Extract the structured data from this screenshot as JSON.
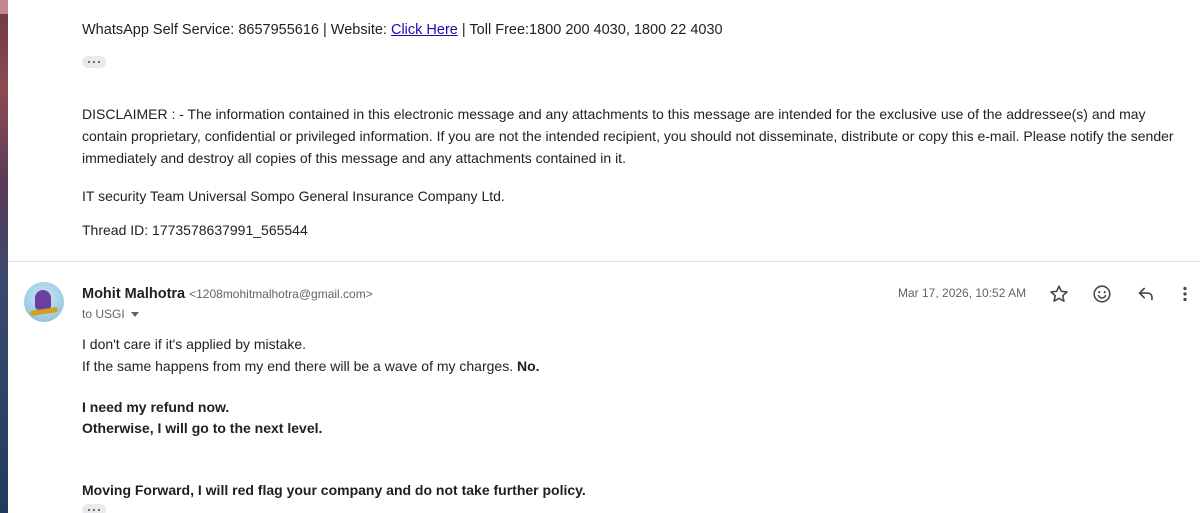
{
  "previous_message": {
    "signature_prefix": "WhatsApp Self Service: 8657955616 | Website: ",
    "link_text": "Click Here",
    "signature_suffix": " | Toll Free:1800 200 4030, 1800 22 4030",
    "disclaimer": "DISCLAIMER : - The information contained in this electronic message and any attachments to this message are intended for the exclusive use of the addressee(s) and may contain proprietary, confidential or privileged information. If you are not the intended recipient, you should not disseminate, distribute or copy this e-mail. Please notify the sender immediately and destroy all copies of this message and any attachments contained in it.",
    "security_team": "IT security Team Universal Sompo General Insurance Company Ltd.",
    "thread_id": "Thread ID: 1773578637991_565544"
  },
  "message": {
    "sender_name": "Mohit Malhotra",
    "sender_email": "<1208mohitmalhotra@gmail.com>",
    "to_label": "to USGI",
    "date": "Mar 17, 2026, 10:52 AM",
    "line1": "I don't care if it's applied by mistake.",
    "line2_prefix": "If the same happens from my end there will be a wave of my charges. ",
    "line2_bold": "No.",
    "line3": "I need my refund now.",
    "line4": "Otherwise, I will go to the next level.",
    "line5": "Moving Forward, I will red flag your company and do not take further policy."
  },
  "icons": {
    "star": "star-icon",
    "emoji": "emoji-icon",
    "reply": "reply-icon",
    "more": "more-vert-icon"
  },
  "colors": {
    "link": "#1a0dab",
    "icon": "#444746",
    "muted": "#5f6368"
  }
}
